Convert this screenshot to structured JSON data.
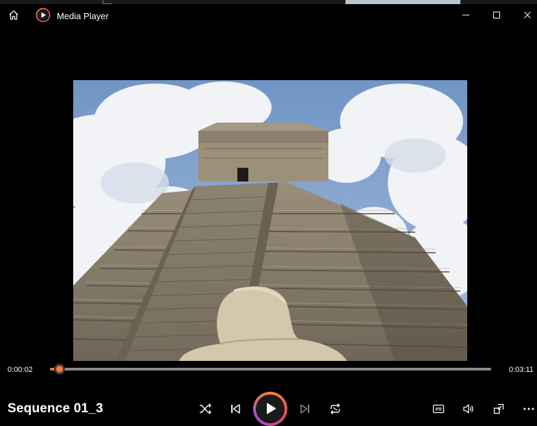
{
  "window": {
    "app_title": "Media Player",
    "icons": {
      "home": "home-icon",
      "app": "media-player-icon",
      "minimize": "minimize-icon",
      "maximize": "maximize-icon",
      "close": "close-icon"
    }
  },
  "player": {
    "elapsed": "0:00:02",
    "duration": "0:03:11",
    "progress_fraction": 0.0105,
    "media_title": "Sequence 01_3",
    "accent_color": "#f0783c"
  },
  "controls": {
    "left": [
      "shuffle-icon",
      "previous-icon"
    ],
    "center": "play-icon",
    "right_of_play": [
      "next-icon",
      "repeat-icon"
    ],
    "right": [
      "captions-icon",
      "volume-icon",
      "mini-player-icon",
      "more-options-icon"
    ]
  }
}
